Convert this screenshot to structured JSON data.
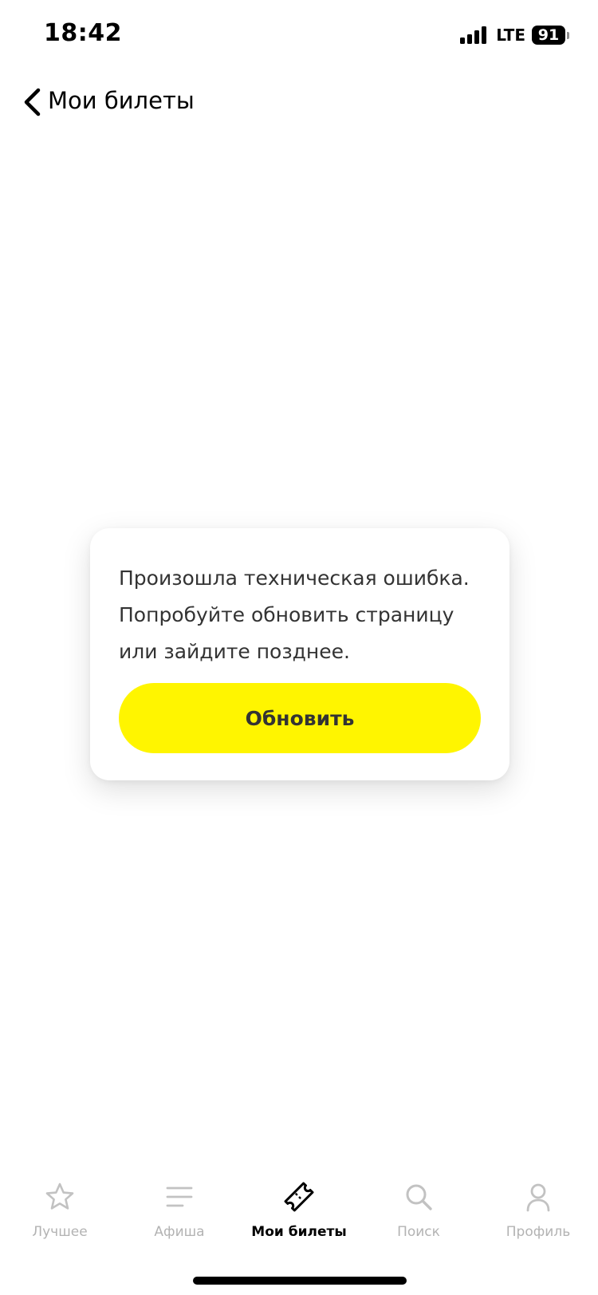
{
  "status_bar": {
    "time": "18:42",
    "network": "LTE",
    "battery": "91"
  },
  "header": {
    "title": "Мои билеты"
  },
  "error_card": {
    "message": "Произошла техническая ошибка. Попробуйте обновить страницу или зайдите позднее.",
    "button_label": "Обновить",
    "button_color": "#fff500"
  },
  "tab_bar": {
    "items": [
      {
        "label": "Лучшее",
        "icon": "star-icon",
        "active": false
      },
      {
        "label": "Афиша",
        "icon": "list-icon",
        "active": false
      },
      {
        "label": "Мои билеты",
        "icon": "ticket-icon",
        "active": true
      },
      {
        "label": "Поиск",
        "icon": "search-icon",
        "active": false
      },
      {
        "label": "Профиль",
        "icon": "profile-icon",
        "active": false
      }
    ]
  },
  "colors": {
    "accent": "#fff500",
    "inactive": "#b3b3b3",
    "active": "#000000"
  }
}
